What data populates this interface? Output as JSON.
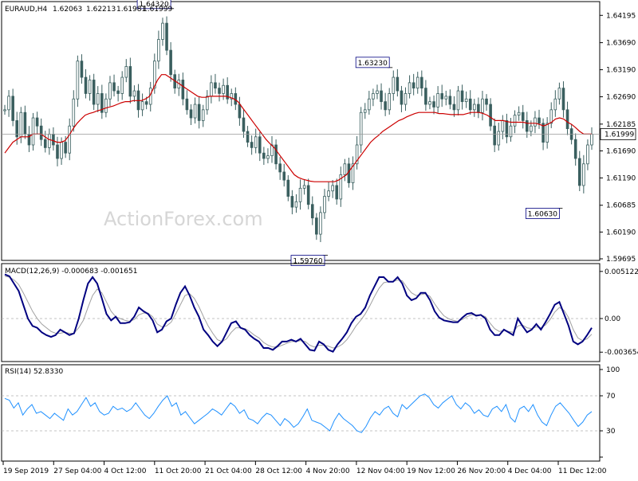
{
  "chart_data": [
    {
      "type": "candlestick",
      "title": "EURAUD,H4",
      "header_values": [
        "1.62063",
        "1.62213",
        "1.61981",
        "1.61999"
      ],
      "current_price_label": "1.61999",
      "current_price": 1.61999,
      "ylim": [
        1.59695,
        1.6442
      ],
      "y_ticks": [
        "1.64195",
        "1.63690",
        "1.63190",
        "1.62690",
        "1.62185",
        "1.61690",
        "1.61190",
        "1.60685",
        "1.60190",
        "1.59695"
      ],
      "watermark": "ActionForex.com",
      "annotations": [
        {
          "label": "1.64320",
          "value": 1.6432
        },
        {
          "label": "1.63230",
          "value": 1.6323
        },
        {
          "label": "1.59760",
          "value": 1.5976
        },
        {
          "label": "1.60630",
          "value": 1.6063
        }
      ],
      "close_series": [
        1.6245,
        1.627,
        1.6225,
        1.6195,
        1.624,
        1.62,
        1.618,
        1.623,
        1.6215,
        1.619,
        1.6175,
        1.62,
        1.618,
        1.6155,
        1.6185,
        1.6165,
        1.6215,
        1.6265,
        1.6335,
        1.6305,
        1.6275,
        1.63,
        1.6255,
        1.6275,
        1.624,
        1.6265,
        1.6295,
        1.628,
        1.6275,
        1.6305,
        1.6325,
        1.627,
        1.628,
        1.6245,
        1.626,
        1.6255,
        1.6285,
        1.6335,
        1.6375,
        1.6405,
        1.6355,
        1.631,
        1.6285,
        1.63,
        1.6265,
        1.6245,
        1.623,
        1.6255,
        1.6225,
        1.6245,
        1.627,
        1.6295,
        1.6285,
        1.6275,
        1.629,
        1.6265,
        1.6275,
        1.6255,
        1.623,
        1.6205,
        1.6185,
        1.6175,
        1.6195,
        1.6165,
        1.6155,
        1.616,
        1.618,
        1.6145,
        1.613,
        1.6115,
        1.6085,
        1.6065,
        1.6075,
        1.61,
        1.6105,
        1.607,
        1.6045,
        1.6015,
        1.6055,
        1.6085,
        1.6095,
        1.6105,
        1.608,
        1.6125,
        1.6145,
        1.611,
        1.6145,
        1.618,
        1.624,
        1.6245,
        1.6265,
        1.6275,
        1.628,
        1.626,
        1.6245,
        1.6275,
        1.6305,
        1.628,
        1.6255,
        1.6275,
        1.6295,
        1.6285,
        1.6305,
        1.6285,
        1.6255,
        1.626,
        1.625,
        1.6275,
        1.6265,
        1.627,
        1.6255,
        1.6245,
        1.628,
        1.626,
        1.6265,
        1.6245,
        1.6255,
        1.624,
        1.6265,
        1.6255,
        1.6215,
        1.618,
        1.6205,
        1.6225,
        1.6195,
        1.6215,
        1.6235,
        1.624,
        1.6225,
        1.6205,
        1.6215,
        1.623,
        1.622,
        1.6185,
        1.622,
        1.6245,
        1.6265,
        1.6285,
        1.6245,
        1.621,
        1.619,
        1.6155,
        1.6105,
        1.6145,
        1.618,
        1.62
      ],
      "ma_series": [
        1.6165,
        1.6175,
        1.6185,
        1.619,
        1.6195,
        1.6195,
        1.6195,
        1.62,
        1.62,
        1.62,
        1.6195,
        1.619,
        1.6188,
        1.6185,
        1.6185,
        1.6188,
        1.6198,
        1.621,
        1.622,
        1.6228,
        1.6235,
        1.6238,
        1.624,
        1.6243,
        1.6245,
        1.6248,
        1.625,
        1.6252,
        1.6255,
        1.6258,
        1.626,
        1.626,
        1.6262,
        1.6262,
        1.6262,
        1.6265,
        1.627,
        1.6285,
        1.63,
        1.631,
        1.631,
        1.6305,
        1.63,
        1.6295,
        1.629,
        1.6285,
        1.628,
        1.6275,
        1.627,
        1.6268,
        1.6268,
        1.627,
        1.627,
        1.627,
        1.627,
        1.627,
        1.6268,
        1.6265,
        1.626,
        1.625,
        1.624,
        1.623,
        1.622,
        1.621,
        1.62,
        1.619,
        1.6182,
        1.6175,
        1.6165,
        1.6155,
        1.6145,
        1.6135,
        1.6125,
        1.612,
        1.6117,
        1.6115,
        1.6113,
        1.6112,
        1.6112,
        1.6112,
        1.6112,
        1.6112,
        1.6112,
        1.6115,
        1.612,
        1.6125,
        1.6135,
        1.6145,
        1.6155,
        1.6165,
        1.6175,
        1.6185,
        1.6192,
        1.6198,
        1.6205,
        1.621,
        1.6215,
        1.622,
        1.6225,
        1.6228,
        1.6232,
        1.6235,
        1.6238,
        1.624,
        1.624,
        1.624,
        1.624,
        1.624,
        1.6238,
        1.6238,
        1.6237,
        1.6236,
        1.6236,
        1.6236,
        1.6236,
        1.6238,
        1.624,
        1.624,
        1.624,
        1.6238,
        1.6235,
        1.623,
        1.6225,
        1.6225,
        1.6225,
        1.6223,
        1.6222,
        1.6222,
        1.6222,
        1.6222,
        1.622,
        1.622,
        1.622,
        1.6218,
        1.6215,
        1.6218,
        1.6222,
        1.6228,
        1.623,
        1.6228,
        1.6222,
        1.6218,
        1.6212,
        1.6205,
        1.62,
        1.62,
        1.62
      ],
      "x_labels": [
        "19 Sep 2019",
        "27 Sep 04:00",
        "4 Oct 12:00",
        "11 Oct 20:00",
        "21 Oct 04:00",
        "28 Oct 12:00",
        "4 Nov 20:00",
        "12 Nov 04:00",
        "19 Nov 12:00",
        "26 Nov 20:00",
        "4 Dec 04:00",
        "11 Dec 12:00"
      ],
      "series": [
        {
          "name": "MA",
          "color": "#cc0000"
        },
        {
          "name": "EURAUD",
          "color": "#333333"
        }
      ]
    },
    {
      "type": "line",
      "title": "MACD(12,26,9) -0.000683 -0.001651",
      "ylim": [
        -0.0045,
        0.0058
      ],
      "y_ticks": [
        "0.005122",
        "0.00",
        "-0.003654"
      ],
      "reference_lines": [
        0.0
      ],
      "series": [
        {
          "name": "MACD",
          "color": "#000080",
          "values": [
            0.0048,
            0.0046,
            0.0038,
            0.003,
            0.0015,
            0.0,
            -0.0008,
            -0.001,
            -0.0015,
            -0.0018,
            -0.002,
            -0.0018,
            -0.0012,
            -0.0015,
            -0.0018,
            -0.0016,
            0.0,
            0.002,
            0.0038,
            0.0045,
            0.0038,
            0.0022,
            0.0005,
            -0.0002,
            0.0002,
            -0.0005,
            -0.0005,
            -0.0004,
            0.0002,
            0.0012,
            0.0008,
            0.0005,
            -0.0002,
            -0.0015,
            -0.0012,
            -0.0003,
            0.0,
            0.0015,
            0.0028,
            0.0035,
            0.0025,
            0.0012,
            0.0002,
            -0.0012,
            -0.0018,
            -0.0025,
            -0.003,
            -0.0025,
            -0.0015,
            -0.0005,
            -0.0003,
            -0.001,
            -0.0012,
            -0.0018,
            -0.0022,
            -0.0025,
            -0.0032,
            -0.0032,
            -0.0034,
            -0.003,
            -0.0025,
            -0.0025,
            -0.0023,
            -0.0025,
            -0.0022,
            -0.0028,
            -0.0034,
            -0.0035,
            -0.0025,
            -0.0028,
            -0.0034,
            -0.0036,
            -0.0028,
            -0.0022,
            -0.0015,
            -0.0005,
            0.0002,
            0.0005,
            0.0012,
            0.0025,
            0.0035,
            0.0045,
            0.0045,
            0.004,
            0.004,
            0.0045,
            0.0038,
            0.0025,
            0.002,
            0.0022,
            0.0028,
            0.0028,
            0.002,
            0.0008,
            0.0001,
            -0.0002,
            -0.0003,
            -0.0004,
            -0.0004,
            0.0001,
            0.0005,
            0.0006,
            0.0003,
            0.0004,
            0.0,
            -0.0012,
            -0.0018,
            -0.0018,
            -0.0012,
            -0.0015,
            -0.0018,
            0.0,
            -0.0008,
            -0.0015,
            -0.0012,
            -0.0006,
            -0.0012,
            -0.0004,
            0.0005,
            0.0015,
            0.0018,
            0.0005,
            -0.0008,
            -0.0025,
            -0.0028,
            -0.0025,
            -0.0018,
            -0.001
          ]
        },
        {
          "name": "Signal",
          "color": "#a0a0a0",
          "values": [
            0.0046,
            0.0045,
            0.0042,
            0.0037,
            0.0028,
            0.0018,
            0.0008,
            0.0,
            -0.0006,
            -0.001,
            -0.0014,
            -0.0016,
            -0.0016,
            -0.0015,
            -0.0016,
            -0.0016,
            -0.001,
            -0.0002,
            0.0012,
            0.0025,
            0.0032,
            0.0028,
            0.0018,
            0.0008,
            0.0002,
            0.0,
            -0.0002,
            -0.0003,
            -0.0001,
            0.0004,
            0.0006,
            0.0006,
            0.0002,
            -0.0006,
            -0.0009,
            -0.0008,
            -0.0004,
            0.0005,
            0.0015,
            0.0025,
            0.0027,
            0.0022,
            0.0013,
            0.0002,
            -0.0008,
            -0.0016,
            -0.0023,
            -0.0025,
            -0.0022,
            -0.0015,
            -0.001,
            -0.001,
            -0.0011,
            -0.0014,
            -0.0018,
            -0.0021,
            -0.0026,
            -0.0029,
            -0.0031,
            -0.0031,
            -0.0029,
            -0.0027,
            -0.0025,
            -0.0025,
            -0.0024,
            -0.0025,
            -0.0029,
            -0.0031,
            -0.0029,
            -0.0029,
            -0.003,
            -0.0032,
            -0.0031,
            -0.0028,
            -0.0023,
            -0.0016,
            -0.0008,
            -0.0002,
            0.0005,
            0.0014,
            0.0024,
            0.0033,
            0.0039,
            0.004,
            0.004,
            0.0042,
            0.0041,
            0.0034,
            0.0028,
            0.0025,
            0.0026,
            0.0027,
            0.0024,
            0.0016,
            0.0009,
            0.0003,
            0.0,
            -0.0002,
            -0.0003,
            -0.0001,
            0.0002,
            0.0004,
            0.0004,
            0.0004,
            0.0002,
            -0.0005,
            -0.0011,
            -0.0014,
            -0.0013,
            -0.0014,
            -0.0015,
            -0.0008,
            -0.0007,
            -0.001,
            -0.0011,
            -0.0009,
            -0.001,
            -0.0007,
            -0.0001,
            0.0007,
            0.0012,
            0.0009,
            0.0001,
            -0.0012,
            -0.0021,
            -0.0024,
            -0.0022,
            -0.0017
          ]
        }
      ]
    },
    {
      "type": "line",
      "title": "RSI(14) 52.8330",
      "ylim": [
        0,
        100
      ],
      "y_ticks": [
        "100",
        "70",
        "30",
        "0"
      ],
      "reference_lines": [
        70,
        30
      ],
      "series": [
        {
          "name": "RSI",
          "color": "#1e90ff",
          "values": [
            67,
            65,
            56,
            62,
            48,
            55,
            60,
            50,
            52,
            48,
            44,
            50,
            46,
            42,
            55,
            48,
            52,
            60,
            68,
            58,
            62,
            52,
            48,
            50,
            58,
            54,
            56,
            52,
            55,
            62,
            55,
            48,
            44,
            50,
            58,
            65,
            70,
            58,
            62,
            48,
            52,
            45,
            38,
            42,
            46,
            50,
            55,
            52,
            48,
            55,
            62,
            58,
            50,
            54,
            44,
            42,
            38,
            45,
            50,
            48,
            42,
            36,
            44,
            40,
            34,
            38,
            46,
            55,
            42,
            40,
            38,
            34,
            30,
            42,
            50,
            44,
            40,
            36,
            30,
            28,
            35,
            45,
            52,
            48,
            55,
            58,
            50,
            46,
            60,
            55,
            60,
            65,
            70,
            72,
            68,
            60,
            56,
            62,
            66,
            70,
            60,
            55,
            62,
            58,
            50,
            54,
            48,
            46,
            55,
            58,
            52,
            60,
            45,
            40,
            55,
            58,
            52,
            60,
            48,
            40,
            36,
            48,
            58,
            62,
            56,
            50,
            42,
            35,
            40,
            48,
            52
          ]
        }
      ]
    }
  ]
}
